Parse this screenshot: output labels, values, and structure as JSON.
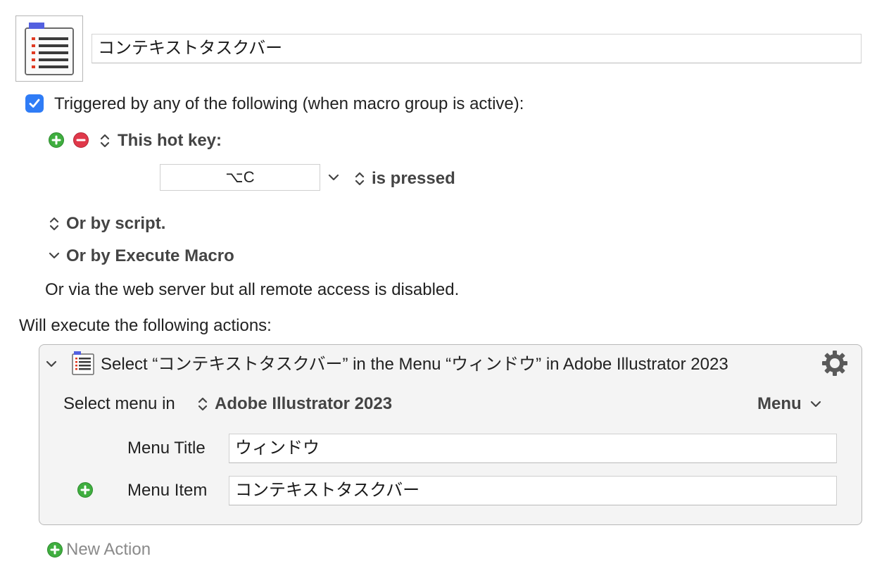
{
  "macro": {
    "name": "コンテキストタスクバー"
  },
  "trigger": {
    "checkbox_label": "Triggered by any of the following (when macro group is active):",
    "checked": true,
    "hotkey_label": "This hot key:",
    "hotkey_value": "⌥C",
    "hotkey_condition": "is pressed",
    "or_script": "Or by script.",
    "or_execute_macro": "Or by Execute Macro",
    "web_server_note": "Or via the web server but all remote access is disabled."
  },
  "actions": {
    "heading": "Will execute the following actions:",
    "items": [
      {
        "title": "Select “コンテキストタスクバー” in the Menu “ウィンドウ” in Adobe Illustrator 2023",
        "select_menu_in_label": "Select menu in",
        "application": "Adobe Illustrator 2023",
        "menu_dropdown": "Menu",
        "menu_title_label": "Menu Title",
        "menu_title_value": "ウィンドウ",
        "menu_item_label": "Menu Item",
        "menu_item_value": "コンテキストタスクバー"
      }
    ],
    "new_action_label": "New Action"
  },
  "colors": {
    "checkbox": "#2f7cf6",
    "add_green": "#3fae3f",
    "remove_red": "#e0384a"
  }
}
